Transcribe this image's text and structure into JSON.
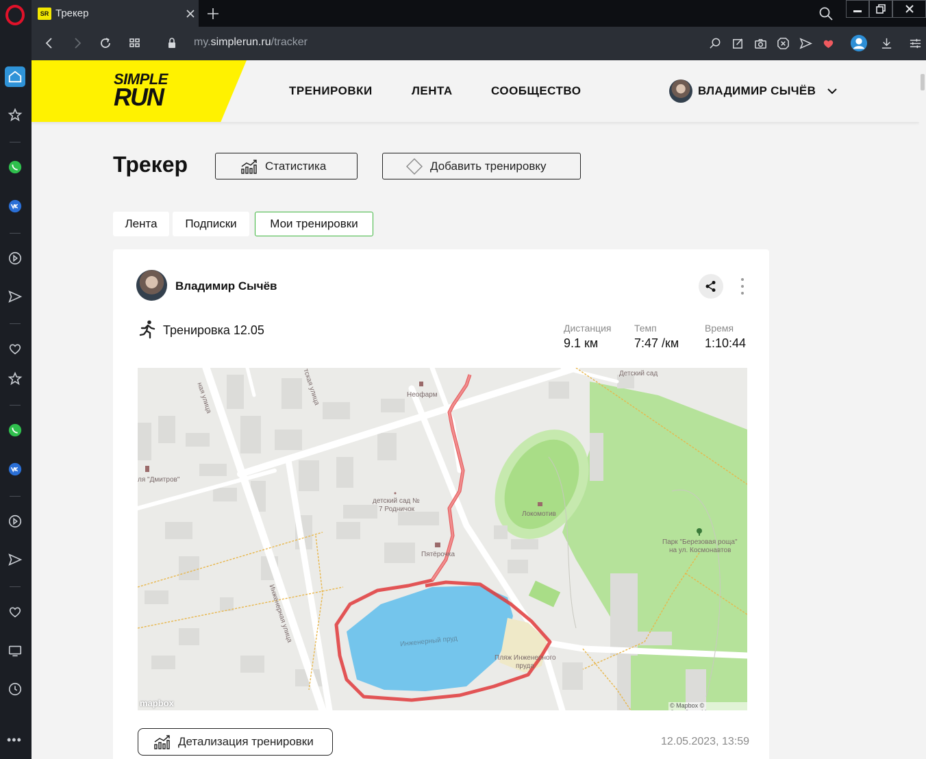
{
  "browser": {
    "tab_title": "Трекер",
    "tab_favicon": "SR",
    "url_prefix": "my.",
    "url_domain": "simplerun.ru",
    "url_path": "/tracker"
  },
  "header": {
    "logo_line1": "SIMPLE",
    "logo_line2": "RUN",
    "nav": [
      "ТРЕНИРОВКИ",
      "ЛЕНТА",
      "СООБЩЕСТВО"
    ],
    "user_name": "ВЛАДИМИР СЫЧЁВ"
  },
  "page": {
    "title": "Трекер",
    "stats_button": "Статистика",
    "add_button": "Добавить тренировку",
    "tabs": [
      {
        "label": "Лента",
        "active": false
      },
      {
        "label": "Подписки",
        "active": false
      },
      {
        "label": "Мои тренировки",
        "active": true
      }
    ]
  },
  "card": {
    "author": "Владимир Сычёв",
    "workout_title": "Тренировка 12.05",
    "stats": [
      {
        "label": "Дистанция",
        "value": "9.1 км"
      },
      {
        "label": "Темп",
        "value": "7:47 /км"
      },
      {
        "label": "Время",
        "value": "1:10:44"
      }
    ],
    "detail_button": "Детализация тренировки",
    "date": "12.05.2023, 13:59"
  },
  "map": {
    "labels": {
      "kindergarten_top": "Детский сад",
      "street_left": "ная улица",
      "street_mid": "тская улица",
      "pharmacy": "Неофарм",
      "hotel": "ля \"Дмитров\"",
      "kindergarten7_1": "детский сад №",
      "kindergarten7_2": "7 Родничок",
      "stadium": "Локомотив",
      "park_1": "Парк \"Березовая роща\"",
      "park_2": "на ул. Космонавтов",
      "shop": "Пятёрочка",
      "street_engineer": "Инженерная улица",
      "pond": "Инженерный пруд",
      "beach_1": "Пляж Инженерного",
      "beach_2": "пруда"
    },
    "credit": "© Mapbox © OpenStreetMap",
    "brand": "mapbox"
  },
  "colors": {
    "logo_yellow": "#fff200",
    "active_tab_border": "#3db53d",
    "route": "#e0393b",
    "water": "#74c5ec",
    "park": "#b5e29a",
    "opera_red": "#e0122a"
  }
}
